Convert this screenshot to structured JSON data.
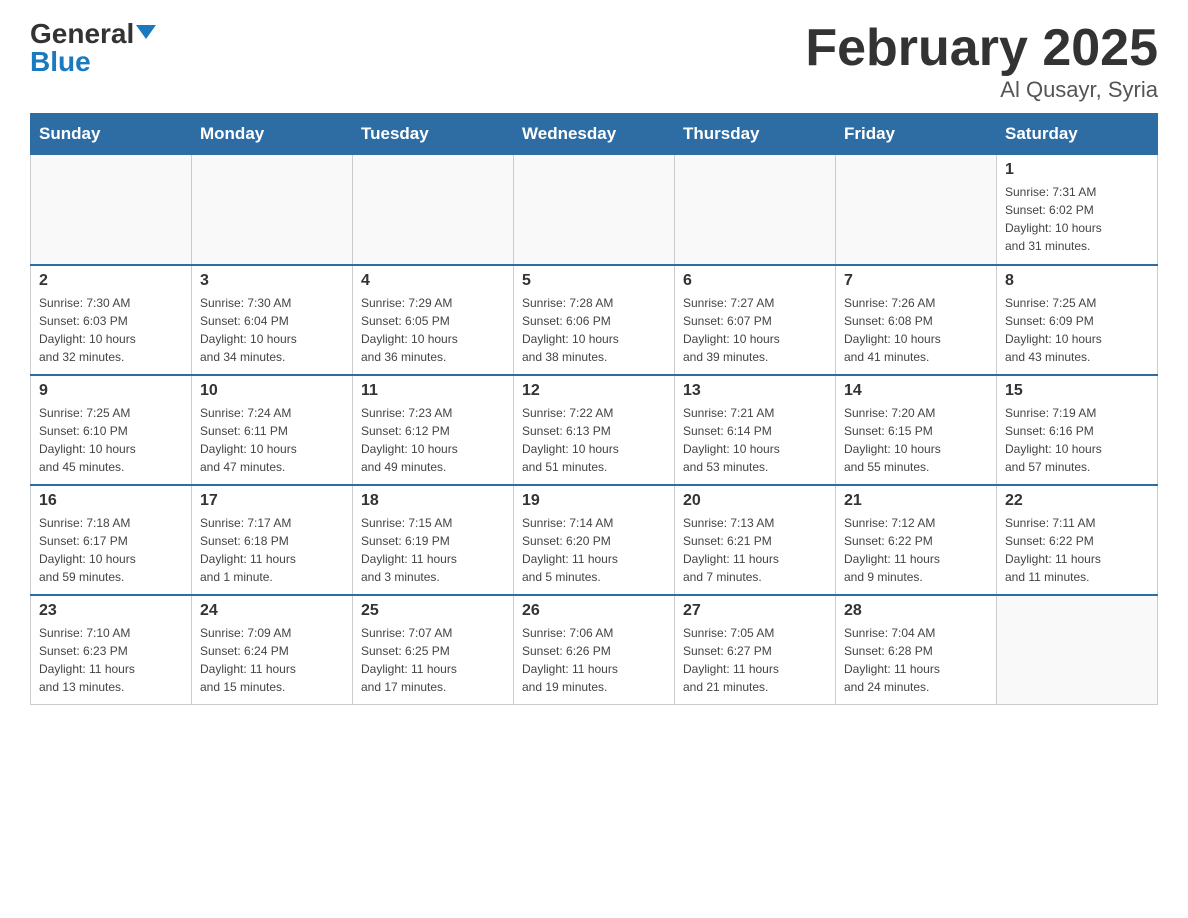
{
  "header": {
    "logo_general": "General",
    "logo_blue": "Blue",
    "title": "February 2025",
    "subtitle": "Al Qusayr, Syria"
  },
  "days_of_week": [
    "Sunday",
    "Monday",
    "Tuesday",
    "Wednesday",
    "Thursday",
    "Friday",
    "Saturday"
  ],
  "weeks": [
    [
      {
        "day": "",
        "info": ""
      },
      {
        "day": "",
        "info": ""
      },
      {
        "day": "",
        "info": ""
      },
      {
        "day": "",
        "info": ""
      },
      {
        "day": "",
        "info": ""
      },
      {
        "day": "",
        "info": ""
      },
      {
        "day": "1",
        "info": "Sunrise: 7:31 AM\nSunset: 6:02 PM\nDaylight: 10 hours\nand 31 minutes."
      }
    ],
    [
      {
        "day": "2",
        "info": "Sunrise: 7:30 AM\nSunset: 6:03 PM\nDaylight: 10 hours\nand 32 minutes."
      },
      {
        "day": "3",
        "info": "Sunrise: 7:30 AM\nSunset: 6:04 PM\nDaylight: 10 hours\nand 34 minutes."
      },
      {
        "day": "4",
        "info": "Sunrise: 7:29 AM\nSunset: 6:05 PM\nDaylight: 10 hours\nand 36 minutes."
      },
      {
        "day": "5",
        "info": "Sunrise: 7:28 AM\nSunset: 6:06 PM\nDaylight: 10 hours\nand 38 minutes."
      },
      {
        "day": "6",
        "info": "Sunrise: 7:27 AM\nSunset: 6:07 PM\nDaylight: 10 hours\nand 39 minutes."
      },
      {
        "day": "7",
        "info": "Sunrise: 7:26 AM\nSunset: 6:08 PM\nDaylight: 10 hours\nand 41 minutes."
      },
      {
        "day": "8",
        "info": "Sunrise: 7:25 AM\nSunset: 6:09 PM\nDaylight: 10 hours\nand 43 minutes."
      }
    ],
    [
      {
        "day": "9",
        "info": "Sunrise: 7:25 AM\nSunset: 6:10 PM\nDaylight: 10 hours\nand 45 minutes."
      },
      {
        "day": "10",
        "info": "Sunrise: 7:24 AM\nSunset: 6:11 PM\nDaylight: 10 hours\nand 47 minutes."
      },
      {
        "day": "11",
        "info": "Sunrise: 7:23 AM\nSunset: 6:12 PM\nDaylight: 10 hours\nand 49 minutes."
      },
      {
        "day": "12",
        "info": "Sunrise: 7:22 AM\nSunset: 6:13 PM\nDaylight: 10 hours\nand 51 minutes."
      },
      {
        "day": "13",
        "info": "Sunrise: 7:21 AM\nSunset: 6:14 PM\nDaylight: 10 hours\nand 53 minutes."
      },
      {
        "day": "14",
        "info": "Sunrise: 7:20 AM\nSunset: 6:15 PM\nDaylight: 10 hours\nand 55 minutes."
      },
      {
        "day": "15",
        "info": "Sunrise: 7:19 AM\nSunset: 6:16 PM\nDaylight: 10 hours\nand 57 minutes."
      }
    ],
    [
      {
        "day": "16",
        "info": "Sunrise: 7:18 AM\nSunset: 6:17 PM\nDaylight: 10 hours\nand 59 minutes."
      },
      {
        "day": "17",
        "info": "Sunrise: 7:17 AM\nSunset: 6:18 PM\nDaylight: 11 hours\nand 1 minute."
      },
      {
        "day": "18",
        "info": "Sunrise: 7:15 AM\nSunset: 6:19 PM\nDaylight: 11 hours\nand 3 minutes."
      },
      {
        "day": "19",
        "info": "Sunrise: 7:14 AM\nSunset: 6:20 PM\nDaylight: 11 hours\nand 5 minutes."
      },
      {
        "day": "20",
        "info": "Sunrise: 7:13 AM\nSunset: 6:21 PM\nDaylight: 11 hours\nand 7 minutes."
      },
      {
        "day": "21",
        "info": "Sunrise: 7:12 AM\nSunset: 6:22 PM\nDaylight: 11 hours\nand 9 minutes."
      },
      {
        "day": "22",
        "info": "Sunrise: 7:11 AM\nSunset: 6:22 PM\nDaylight: 11 hours\nand 11 minutes."
      }
    ],
    [
      {
        "day": "23",
        "info": "Sunrise: 7:10 AM\nSunset: 6:23 PM\nDaylight: 11 hours\nand 13 minutes."
      },
      {
        "day": "24",
        "info": "Sunrise: 7:09 AM\nSunset: 6:24 PM\nDaylight: 11 hours\nand 15 minutes."
      },
      {
        "day": "25",
        "info": "Sunrise: 7:07 AM\nSunset: 6:25 PM\nDaylight: 11 hours\nand 17 minutes."
      },
      {
        "day": "26",
        "info": "Sunrise: 7:06 AM\nSunset: 6:26 PM\nDaylight: 11 hours\nand 19 minutes."
      },
      {
        "day": "27",
        "info": "Sunrise: 7:05 AM\nSunset: 6:27 PM\nDaylight: 11 hours\nand 21 minutes."
      },
      {
        "day": "28",
        "info": "Sunrise: 7:04 AM\nSunset: 6:28 PM\nDaylight: 11 hours\nand 24 minutes."
      },
      {
        "day": "",
        "info": ""
      }
    ]
  ]
}
